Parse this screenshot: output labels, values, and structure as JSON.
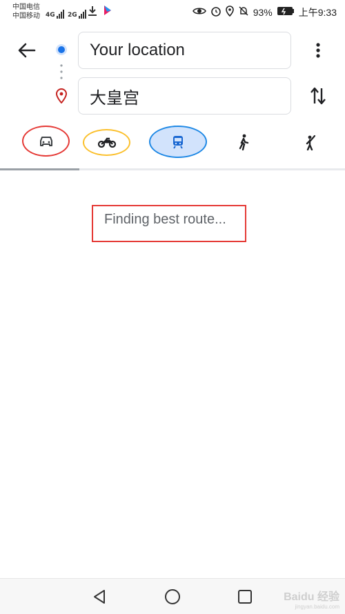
{
  "status_bar": {
    "carrier_1": "中国电信",
    "carrier_2": "中国移动",
    "net_1": "4G",
    "net_2": "2G",
    "battery": "93%",
    "time": "上午9:33"
  },
  "search": {
    "origin_value": "Your location",
    "destination_value": "大皇宫"
  },
  "icons": {
    "back": "arrow-left-icon",
    "menu": "more-vert-icon",
    "swap": "swap-vertical-icon",
    "origin": "origin-dot-icon",
    "destination": "destination-pin-icon",
    "modes": [
      "car-icon",
      "motorcycle-icon",
      "transit-icon",
      "walk-icon",
      "ride-hailing-icon"
    ]
  },
  "modes": {
    "selected": "transit",
    "annotation_colors": {
      "car": "#e53935",
      "motorcycle": "#fbc02d",
      "transit": "#1e88e5"
    }
  },
  "progress": {
    "fraction": 0.23
  },
  "main": {
    "status_text": "Finding best route..."
  },
  "colors": {
    "accent_blue": "#1a73e8",
    "pin_red": "#c5221f",
    "annotation_red": "#e53935"
  },
  "watermark": {
    "text": "Baidu 经验",
    "sub": "jingyan.baidu.com"
  }
}
